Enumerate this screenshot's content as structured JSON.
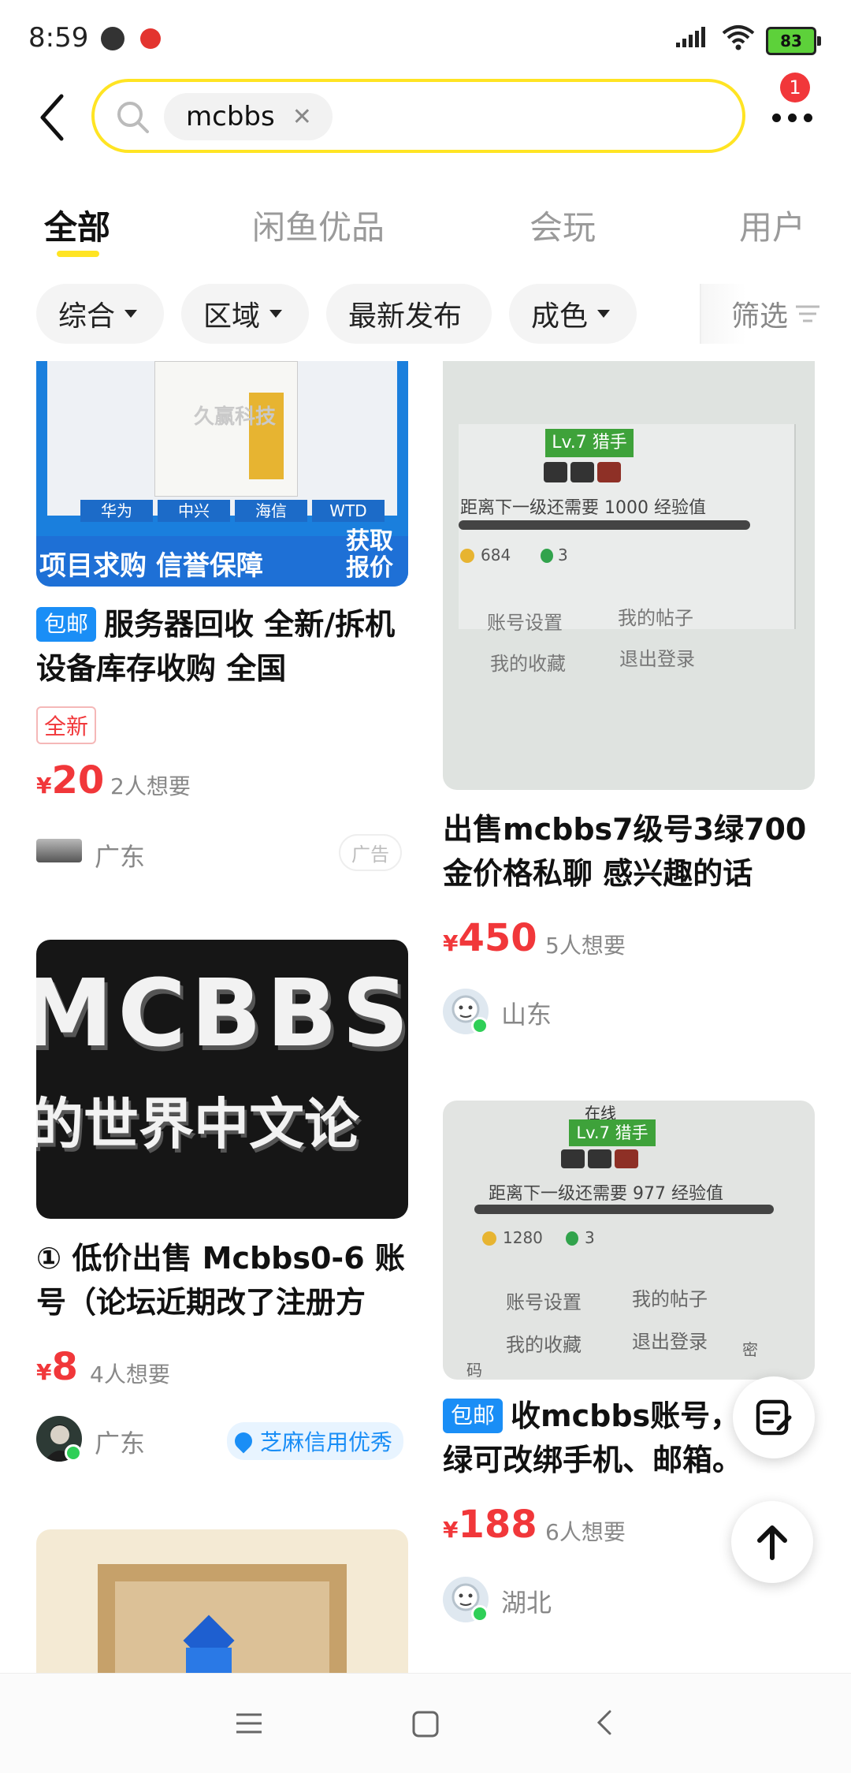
{
  "status": {
    "time": "8:59",
    "battery": "83"
  },
  "search": {
    "query": "mcbbs",
    "notification_count": "1"
  },
  "tabs": [
    {
      "label": "全部"
    },
    {
      "label": "闲鱼优品"
    },
    {
      "label": "会玩"
    },
    {
      "label": "用户"
    }
  ],
  "filters": {
    "sort": "综合",
    "region": "区域",
    "latest": "最新发布",
    "condition": "成色",
    "filter": "筛选"
  },
  "items": [
    {
      "img_text": {
        "banner": "项目求购 信誉保障",
        "get_quote": "获取报价",
        "brand1": "华为",
        "brand2": "中兴",
        "brand3": "海信",
        "brand4": "WTD",
        "watermark": "久赢科技"
      },
      "tag": "包邮",
      "title": "服务器回收 全新/拆机设备库存收购 全国",
      "condition_tag": "全新",
      "currency": "¥",
      "price": "20",
      "want": "2人想要",
      "location": "广东",
      "ad_label": "广告"
    },
    {
      "img_text": {
        "level": "Lv.7 猎手",
        "next": "距离下一级还需要 1000 经验值",
        "gold": "684",
        "gems": "3",
        "m1": "账号设置",
        "m2": "我的帖子",
        "m3": "我的收藏",
        "m4": "退出登录"
      },
      "title": "出售mcbbs7级号3绿700金价格私聊 感兴趣的话",
      "currency": "¥",
      "price": "450",
      "want": "5人想要",
      "location": "山东"
    },
    {
      "img_text": {
        "line1": "MCBBS",
        "line2": "的世界中文论"
      },
      "title": "① 低价出售 Mcbbs0-6 账号（论坛近期改了注册方",
      "currency": "¥",
      "price": "8",
      "want": "4人想要",
      "location": "广东",
      "credit": "芝麻信用优秀"
    },
    {
      "img_text": {
        "top": "在线",
        "level": "Lv.7 猎手",
        "next": "距离下一级还需要 977 经验值",
        "gold": "1280",
        "gems": "3",
        "m1": "账号设置",
        "m2": "我的帖子",
        "m3": "我的收藏",
        "m4": "退出登录",
        "edge1": "密",
        "edge2": "码"
      },
      "tag": "包邮",
      "title": "收mcbbs账号，带绿可改绑手机、邮箱。",
      "currency": "¥",
      "price": "188",
      "want": "6人想要",
      "location": "湖北"
    }
  ]
}
